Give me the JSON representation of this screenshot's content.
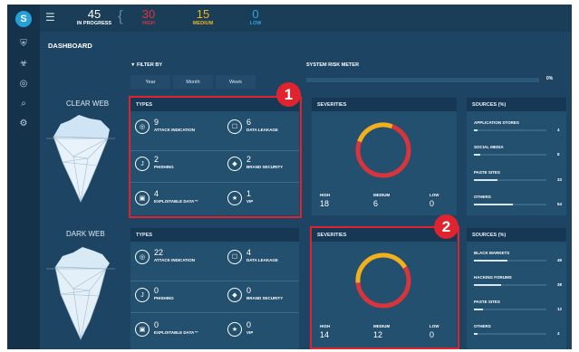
{
  "topbar": {
    "in_progress": {
      "value": "45",
      "label": "IN PROGRESS"
    },
    "high": {
      "value": "30",
      "label": "HIGH",
      "color": "#e2333c"
    },
    "medium": {
      "value": "15",
      "label": "MEDIUM",
      "color": "#f2b21b"
    },
    "low": {
      "value": "0",
      "label": "LOW",
      "color": "#2aa8e0"
    }
  },
  "sidebar": {
    "logo": "S",
    "icons": [
      "shield-icon",
      "biohazard-icon",
      "radar-icon",
      "search-icon",
      "settings-icon"
    ]
  },
  "dashboard": {
    "title": "DASHBOARD"
  },
  "filter": {
    "label": "FILTER BY",
    "buttons": [
      "Year",
      "Month",
      "Week"
    ]
  },
  "risk_meter": {
    "label": "SYSTEM RISK METER",
    "value": "0%",
    "fraction": 0
  },
  "clear_web": {
    "title": "CLEAR WEB",
    "types": {
      "title": "TYPES",
      "items": [
        {
          "count": "9",
          "label": "ATTACK INDICATION",
          "icon": "target-icon"
        },
        {
          "count": "6",
          "label": "DATA LEAKAGE",
          "icon": "unlock-icon"
        },
        {
          "count": "2",
          "label": "PHISHING",
          "icon": "hook-icon"
        },
        {
          "count": "2",
          "label": "BRAND SECURITY",
          "icon": "shield-icon"
        },
        {
          "count": "4",
          "label": "EXPLOITABLE DATA™",
          "icon": "lock-icon"
        },
        {
          "count": "1",
          "label": "VIP",
          "icon": "medal-icon"
        }
      ]
    },
    "severities": {
      "title": "SEVERITIES",
      "high": {
        "label": "HIGH",
        "value": "18"
      },
      "medium": {
        "label": "MEDIUM",
        "value": "6"
      },
      "low": {
        "label": "LOW",
        "value": "0"
      }
    },
    "sources": {
      "title": "SOURCES (%)",
      "items": [
        {
          "label": "APPLICATION STORES",
          "value": "4",
          "fraction": 0.04
        },
        {
          "label": "SOCIAL MEDIA",
          "value": "8",
          "fraction": 0.08
        },
        {
          "label": "PASTE SITES",
          "value": "33",
          "fraction": 0.33
        },
        {
          "label": "OTHERS",
          "value": "54",
          "fraction": 0.54
        }
      ]
    }
  },
  "dark_web": {
    "title": "DARK WEB",
    "types": {
      "title": "TYPES",
      "items": [
        {
          "count": "22",
          "label": "ATTACK INDICATION",
          "icon": "target-icon"
        },
        {
          "count": "4",
          "label": "DATA LEAKAGE",
          "icon": "unlock-icon"
        },
        {
          "count": "0",
          "label": "PHISHING",
          "icon": "hook-icon"
        },
        {
          "count": "0",
          "label": "BRAND SECURITY",
          "icon": "shield-icon"
        },
        {
          "count": "0",
          "label": "EXPLOITABLE DATA™",
          "icon": "lock-icon"
        },
        {
          "count": "0",
          "label": "VIP",
          "icon": "medal-icon"
        }
      ]
    },
    "severities": {
      "title": "SEVERITIES",
      "high": {
        "label": "HIGH",
        "value": "14"
      },
      "medium": {
        "label": "MEDIUM",
        "value": "12"
      },
      "low": {
        "label": "LOW",
        "value": "0"
      }
    },
    "sources": {
      "title": "SOURCES (%)",
      "items": [
        {
          "label": "BLACK MARKETS",
          "value": "46",
          "fraction": 0.46
        },
        {
          "label": "HACKING FORUMS",
          "value": "38",
          "fraction": 0.38
        },
        {
          "label": "PASTE SITES",
          "value": "12",
          "fraction": 0.12
        },
        {
          "label": "OTHERS",
          "value": "4",
          "fraction": 0.04
        }
      ]
    }
  },
  "callouts": [
    "1",
    "2"
  ],
  "colors": {
    "high": "#d8343c",
    "medium": "#efb21c",
    "callout": "#e0242f"
  }
}
